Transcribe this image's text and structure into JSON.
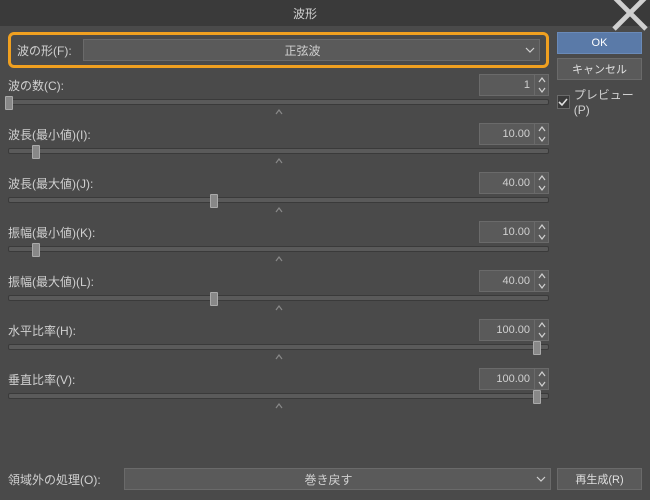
{
  "title": "波形",
  "buttons": {
    "ok": "OK",
    "cancel": "キャンセル",
    "regenerate": "再生成(R)"
  },
  "preview": {
    "label": "プレビュー(P)",
    "checked": true
  },
  "waveform": {
    "label": "波の形(F):",
    "value": "正弦波"
  },
  "params": [
    {
      "label": "波の数(C):",
      "value": "1",
      "thumb_pct": 0
    },
    {
      "label": "波長(最小値)(I):",
      "value": "10.00",
      "thumb_pct": 5
    },
    {
      "label": "波長(最大値)(J):",
      "value": "40.00",
      "thumb_pct": 38
    },
    {
      "label": "振幅(最小値)(K):",
      "value": "10.00",
      "thumb_pct": 5
    },
    {
      "label": "振幅(最大値)(L):",
      "value": "40.00",
      "thumb_pct": 38
    },
    {
      "label": "水平比率(H):",
      "value": "100.00",
      "thumb_pct": 98
    },
    {
      "label": "垂直比率(V):",
      "value": "100.00",
      "thumb_pct": 98
    }
  ],
  "outside": {
    "label": "領域外の処理(O):",
    "value": "巻き戻す"
  }
}
